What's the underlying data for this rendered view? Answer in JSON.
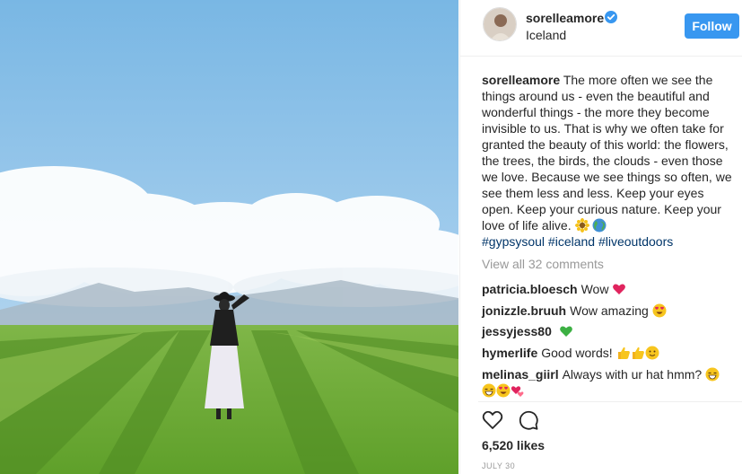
{
  "post": {
    "username": "sorelleamore",
    "location": "Iceland",
    "follow_label": "Follow",
    "verified": true
  },
  "caption": {
    "author": "sorelleamore",
    "text": "The more often we see the things around us - even the beautiful and wonderful things - the more they become invisible to us. That is why we often take for granted the beauty of this world: the flowers, the trees, the birds, the clouds - even those we love. Because we see things so often, we see them less and less. Keep your eyes open. Keep your curious nature. Keep your love of life alive.",
    "emojis": [
      "sunflower-emoji",
      "globe-emoji"
    ],
    "hashtags": "#gypsysoul #iceland #liveoutdoors"
  },
  "view_all_comments": "View all 32 comments",
  "comments": [
    {
      "user": "patricia.bloesch",
      "text": "Wow",
      "emojis": [
        "heart-emoji"
      ]
    },
    {
      "user": "jonizzle.bruuh",
      "text": "Wow amazing",
      "emojis": [
        "heart-eyes-emoji"
      ]
    },
    {
      "user": "jessyjess80",
      "text": "",
      "emojis": [
        "green-heart-emoji"
      ]
    },
    {
      "user": "hymerlife",
      "text": "Good words!",
      "emojis": [
        "thumbs-up-emoji",
        "thumbs-up-emoji",
        "smile-emoji"
      ]
    },
    {
      "user": "melinas_giirl",
      "text": "Always with ur hat hmm?",
      "emojis": [
        "grin-emoji",
        "grin-emoji",
        "heart-eyes-emoji",
        "hearts-emoji"
      ]
    }
  ],
  "likes": "6,520 likes",
  "date": "JULY 30",
  "colors": {
    "accent": "#3897f0",
    "hashtag": "#003569",
    "muted": "#999999"
  }
}
